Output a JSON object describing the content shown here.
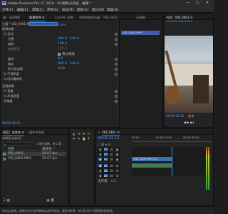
{
  "app": {
    "logo_text": "Pr",
    "title": "Adobe Premiere Pro CC 2018 - D:\\视频\\未命名 - 编辑 *",
    "min": "—",
    "max": "□",
    "close": "✕"
  },
  "menu": [
    "文件(F)",
    "编辑(E)",
    "剪辑(C)",
    "序列(S)",
    "标记(M)",
    "图形(G)",
    "窗口(W)",
    "帮助(H)"
  ],
  "effect_controls": {
    "tabs": [
      "源：(无剪辑)",
      "效果控件 ≡",
      "Lumetri 范围",
      "音频剪辑混合器：VID_0401",
      "元数据"
    ],
    "source_clip": "主要 * VID_0401.MP4",
    "sequence_clip": "VID_0401 * VID_0401.MP4",
    "section_video": "视频效果",
    "motion": "fx 运动",
    "position": {
      "label": "位置",
      "x": "960.0",
      "y": "540.0"
    },
    "scale": {
      "label": "缩放",
      "value": "100.0"
    },
    "scale_width": {
      "label": "缩放宽度",
      "value": "100.0"
    },
    "uniform_scale": "等比缩放",
    "rotation": {
      "label": "旋转",
      "value": "0.0"
    },
    "anchor": {
      "label": "锚点",
      "x": "960.0",
      "y": "540.0"
    },
    "antiflicker": {
      "label": "防闪烁滤镜",
      "value": "0.00"
    },
    "opacity": "fx 不透明度",
    "time_remap": "fx 时间重映射",
    "section_audio": "音频效果",
    "volume": "fx 音量",
    "channel_volume": "fx 声道音量",
    "panner": "声像器",
    "timecode": "00:00:32:12",
    "mini_clip_label": "VID_0401.MP4"
  },
  "program": {
    "tabs": [
      "节目：VID_0401 ≡"
    ],
    "timecode": "00:00:32:12",
    "fit": "适合"
  },
  "project": {
    "tabs": [
      "项目：未命名 ≡",
      "媒体浏览器"
    ],
    "name": "未命名.prproj",
    "count": "1 项已选择，共 2 项",
    "col_name": "名称",
    "col_fps": "帧速率 ^",
    "items": [
      {
        "name": "VID_0401",
        "fps": "29.97 fps"
      },
      {
        "name": "VID_0401.MP4",
        "fps": "29.97 fps"
      }
    ]
  },
  "timeline": {
    "tabs": [
      "VID_0401 ≡"
    ],
    "timecode": "00:00:32:12",
    "ruler": [
      "00:00",
      "00:00:15:00",
      "00:00:30:00"
    ],
    "video_tracks": [
      "V3",
      "V2",
      "V1"
    ],
    "audio_tracks": [
      "A1",
      "A2",
      "A3"
    ],
    "master": "主声道",
    "master_value": "0.0",
    "video_clip": "VID_0401.MP4 [V]",
    "btn_m": "M",
    "btn_s": "S",
    "btn_lock": "🔒",
    "btn_eye": "👁",
    "meter_labels": [
      "0",
      "-12",
      "-24",
      "-36",
      "-48",
      "dB"
    ]
  },
  "status": {
    "text": "单击以选择，或单击空白处并拖动以进行框选。使用 Shift、Alt 和 Ctrl 可获得其他选项。"
  }
}
